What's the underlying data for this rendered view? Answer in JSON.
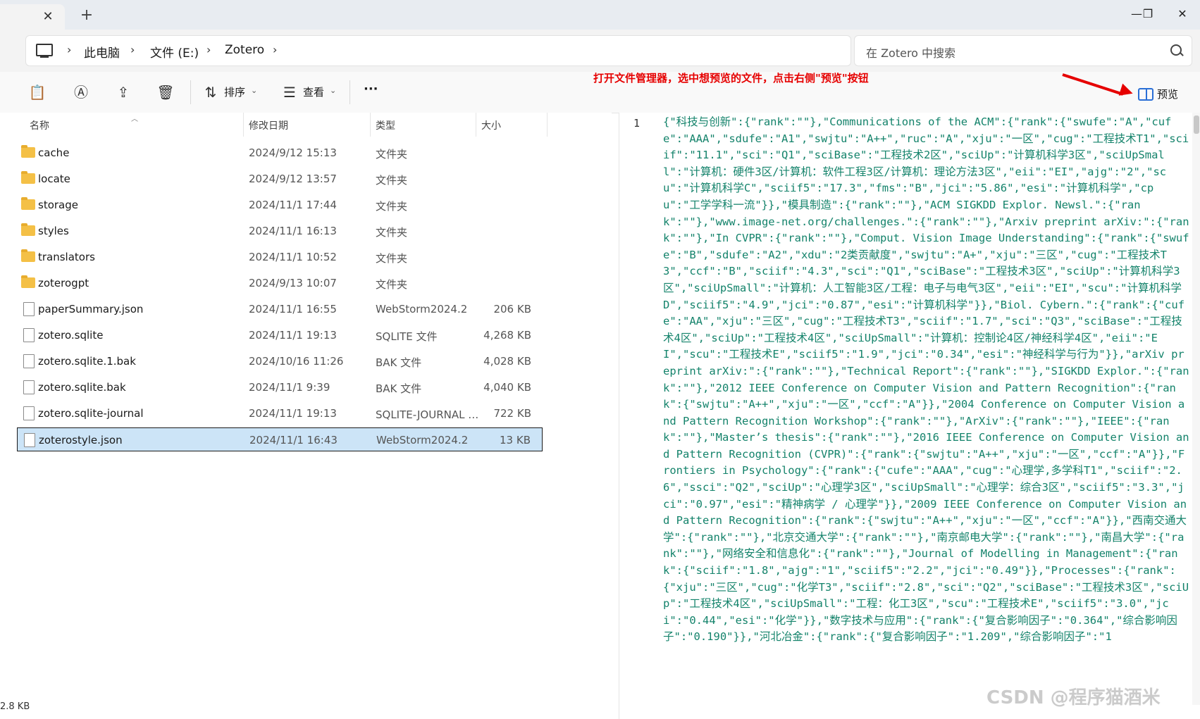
{
  "window": {
    "tab_close": "✕",
    "new_tab": "+",
    "minimize": "—",
    "maximize": "❐",
    "close": "✕"
  },
  "address": {
    "crumbs": [
      "此电脑",
      "文件 (E:)",
      "Zotero"
    ],
    "separator": "›",
    "search_placeholder": "在 Zotero 中搜索"
  },
  "toolbar": {
    "sort_label": "排序",
    "view_label": "查看",
    "more": "···",
    "annotation": "打开文件管理器，选中想预览的文件，点击右侧\"预览\"按钮",
    "preview_label": "预览"
  },
  "columns": {
    "name": "名称",
    "date": "修改日期",
    "type": "类型",
    "size": "大小"
  },
  "files": [
    {
      "name": "cache",
      "date": "2024/9/12 15:13",
      "type": "文件夹",
      "size": "",
      "icon": "folder-icon"
    },
    {
      "name": "locate",
      "date": "2024/9/12 13:57",
      "type": "文件夹",
      "size": "",
      "icon": "folder-icon"
    },
    {
      "name": "storage",
      "date": "2024/11/1 17:44",
      "type": "文件夹",
      "size": "",
      "icon": "folder-icon"
    },
    {
      "name": "styles",
      "date": "2024/11/1 16:13",
      "type": "文件夹",
      "size": "",
      "icon": "folder-icon"
    },
    {
      "name": "translators",
      "date": "2024/11/1 10:52",
      "type": "文件夹",
      "size": "",
      "icon": "folder-icon"
    },
    {
      "name": "zoterogpt",
      "date": "2024/9/13 10:07",
      "type": "文件夹",
      "size": "",
      "icon": "folder-icon"
    },
    {
      "name": "paperSummary.json",
      "date": "2024/11/1 16:55",
      "type": "WebStorm2024.2",
      "size": "206 KB",
      "icon": "file-icon"
    },
    {
      "name": "zotero.sqlite",
      "date": "2024/11/1 19:13",
      "type": "SQLITE 文件",
      "size": "4,268 KB",
      "icon": "file-icon"
    },
    {
      "name": "zotero.sqlite.1.bak",
      "date": "2024/10/16 11:26",
      "type": "BAK 文件",
      "size": "4,028 KB",
      "icon": "file-icon"
    },
    {
      "name": "zotero.sqlite.bak",
      "date": "2024/11/1 9:39",
      "type": "BAK 文件",
      "size": "4,040 KB",
      "icon": "file-icon"
    },
    {
      "name": "zotero.sqlite-journal",
      "date": "2024/11/1 19:13",
      "type": "SQLITE-JOURNAL 文件",
      "size": "722 KB",
      "icon": "file-icon"
    },
    {
      "name": "zoterostyle.json",
      "date": "2024/11/1 16:43",
      "type": "WebStorm2024.2",
      "size": "13 KB",
      "icon": "file-icon",
      "selected": true
    }
  ],
  "status": "2.8 KB",
  "preview": {
    "line_number": "1",
    "content": "{\"科技与创新\":{\"rank\":\"\"},\"Communications of the ACM\":{\"rank\":{\"swufe\":\"A\",\"cufe\":\"AAA\",\"sdufe\":\"A1\",\"swjtu\":\"A++\",\"ruc\":\"A\",\"xju\":\"一区\",\"cug\":\"工程技术T1\",\"sciif\":\"11.1\",\"sci\":\"Q1\",\"sciBase\":\"工程技术2区\",\"sciUp\":\"计算机科学3区\",\"sciUpSmall\":\"计算机：硬件3区/计算机：软件工程3区/计算机：理论方法3区\",\"eii\":\"EI\",\"ajg\":\"2\",\"scu\":\"计算机科学C\",\"sciif5\":\"17.3\",\"fms\":\"B\",\"jci\":\"5.86\",\"esi\":\"计算机科学\",\"cpu\":\"工学学科一流\"}},\"模具制造\":{\"rank\":\"\"},\"ACM SIGKDD Explor. Newsl.\":{\"rank\":\"\"},\"www.image-net.org/challenges.\":{\"rank\":\"\"},\"Arxiv preprint arXiv:\":{\"rank\":\"\"},\"In CVPR\":{\"rank\":\"\"},\"Comput. Vision Image Understanding\":{\"rank\":{\"swufe\":\"B\",\"sdufe\":\"A2\",\"xdu\":\"2类贡献度\",\"swjtu\":\"A+\",\"xju\":\"三区\",\"cug\":\"工程技术T3\",\"ccf\":\"B\",\"sciif\":\"4.3\",\"sci\":\"Q1\",\"sciBase\":\"工程技术3区\",\"sciUp\":\"计算机科学3区\",\"sciUpSmall\":\"计算机：人工智能3区/工程：电子与电气3区\",\"eii\":\"EI\",\"scu\":\"计算机科学D\",\"sciif5\":\"4.9\",\"jci\":\"0.87\",\"esi\":\"计算机科学\"}},\"Biol. Cybern.\":{\"rank\":{\"cufe\":\"AA\",\"xju\":\"三区\",\"cug\":\"工程技术T3\",\"sciif\":\"1.7\",\"sci\":\"Q3\",\"sciBase\":\"工程技术4区\",\"sciUp\":\"工程技术4区\",\"sciUpSmall\":\"计算机：控制论4区/神经科学4区\",\"eii\":\"EI\",\"scu\":\"工程技术E\",\"sciif5\":\"1.9\",\"jci\":\"0.34\",\"esi\":\"神经科学与行为\"}},\"arXiv preprint arXiv:\":{\"rank\":\"\"},\"Technical Report\":{\"rank\":\"\"},\"SIGKDD Explor.\":{\"rank\":\"\"},\"2012 IEEE Conference on Computer Vision and Pattern Recognition\":{\"rank\":{\"swjtu\":\"A++\",\"xju\":\"一区\",\"ccf\":\"A\"}},\"2004 Conference on Computer Vision and Pattern Recognition Workshop\":{\"rank\":\"\"},\"ArXiv\":{\"rank\":\"\"},\"IEEE\":{\"rank\":\"\"},\"Master’s thesis\":{\"rank\":\"\"},\"2016 IEEE Conference on Computer Vision and Pattern Recognition (CVPR)\":{\"rank\":{\"swjtu\":\"A++\",\"xju\":\"一区\",\"ccf\":\"A\"}},\"Frontiers in Psychology\":{\"rank\":{\"cufe\":\"AAA\",\"cug\":\"心理学,多学科T1\",\"sciif\":\"2.6\",\"ssci\":\"Q2\",\"sciUp\":\"心理学3区\",\"sciUpSmall\":\"心理学：综合3区\",\"sciif5\":\"3.3\",\"jci\":\"0.97\",\"esi\":\"精神病学 / 心理学\"}},\"2009 IEEE Conference on Computer Vision and Pattern Recognition\":{\"rank\":{\"swjtu\":\"A++\",\"xju\":\"一区\",\"ccf\":\"A\"}},\"西南交通大学\":{\"rank\":\"\"},\"北京交通大学\":{\"rank\":\"\"},\"南京邮电大学\":{\"rank\":\"\"},\"南昌大学\":{\"rank\":\"\"},\"网络安全和信息化\":{\"rank\":\"\"},\"Journal of Modelling in Management\":{\"rank\":{\"sciif\":\"1.8\",\"ajg\":\"1\",\"sciif5\":\"2.2\",\"jci\":\"0.49\"}},\"Processes\":{\"rank\":{\"xju\":\"三区\",\"cug\":\"化学T3\",\"sciif\":\"2.8\",\"sci\":\"Q2\",\"sciBase\":\"工程技术3区\",\"sciUp\":\"工程技术4区\",\"sciUpSmall\":\"工程：化工3区\",\"scu\":\"工程技术E\",\"sciif5\":\"3.0\",\"jci\":\"0.44\",\"esi\":\"化学\"}},\"数字技术与应用\":{\"rank\":{\"复合影响因子\":\"0.364\",\"综合影响因子\":\"0.190\"}},\"河北冶金\":{\"rank\":{\"复合影响因子\":\"1.209\",\"综合影响因子\":\"1"
  },
  "watermark": "CSDN @程序猫酒米"
}
